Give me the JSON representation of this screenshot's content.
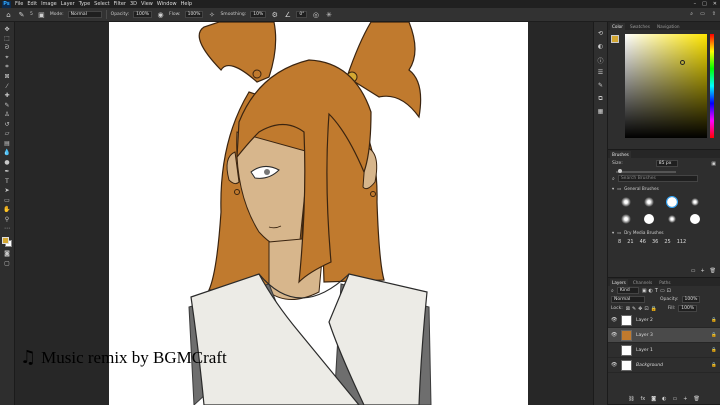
{
  "menubar": {
    "logo": "Ps",
    "items": [
      "File",
      "Edit",
      "Image",
      "Layer",
      "Type",
      "Select",
      "Filter",
      "3D",
      "View",
      "Window",
      "Help"
    ]
  },
  "options": {
    "mode_label": "Mode:",
    "mode_value": "Normal",
    "opacity_label": "Opacity:",
    "opacity_value": "100%",
    "flow_label": "Flow:",
    "flow_value": "100%",
    "smoothing_label": "Smoothing:",
    "smoothing_value": "10%",
    "angle_value": "0°",
    "brush_size": "5"
  },
  "color_panel": {
    "tabs": [
      "Color",
      "Swatches",
      "Navigation"
    ],
    "foreground": "#d3a732",
    "background": "#ffffff"
  },
  "brushes_panel": {
    "tab": "Brushes",
    "size_label": "Size:",
    "size_value": "85 px",
    "search_placeholder": "Search Brushes",
    "group_general": "General Brushes",
    "group_dry": "Dry Media Brushes",
    "brush_size_numbers": [
      "8",
      "21",
      "46",
      "36",
      "25",
      "112"
    ]
  },
  "layers_panel": {
    "tabs": [
      "Layers",
      "Channels",
      "Paths"
    ],
    "filter_label": "Kind",
    "blend_mode": "Normal",
    "opacity_label": "Opacity:",
    "opacity_value": "100%",
    "lock_label": "Lock:",
    "fill_label": "Fill:",
    "fill_value": "100%",
    "layers": [
      "Layer 2",
      "Layer 3",
      "Layer 1",
      "Background"
    ]
  },
  "caption": {
    "text": "Music remix by BGMCraft"
  },
  "colors": {
    "hair": "#c07a2e",
    "skin": "#d7b68c",
    "robe": "#ecebe6",
    "mesh": "#6e6e6e"
  }
}
